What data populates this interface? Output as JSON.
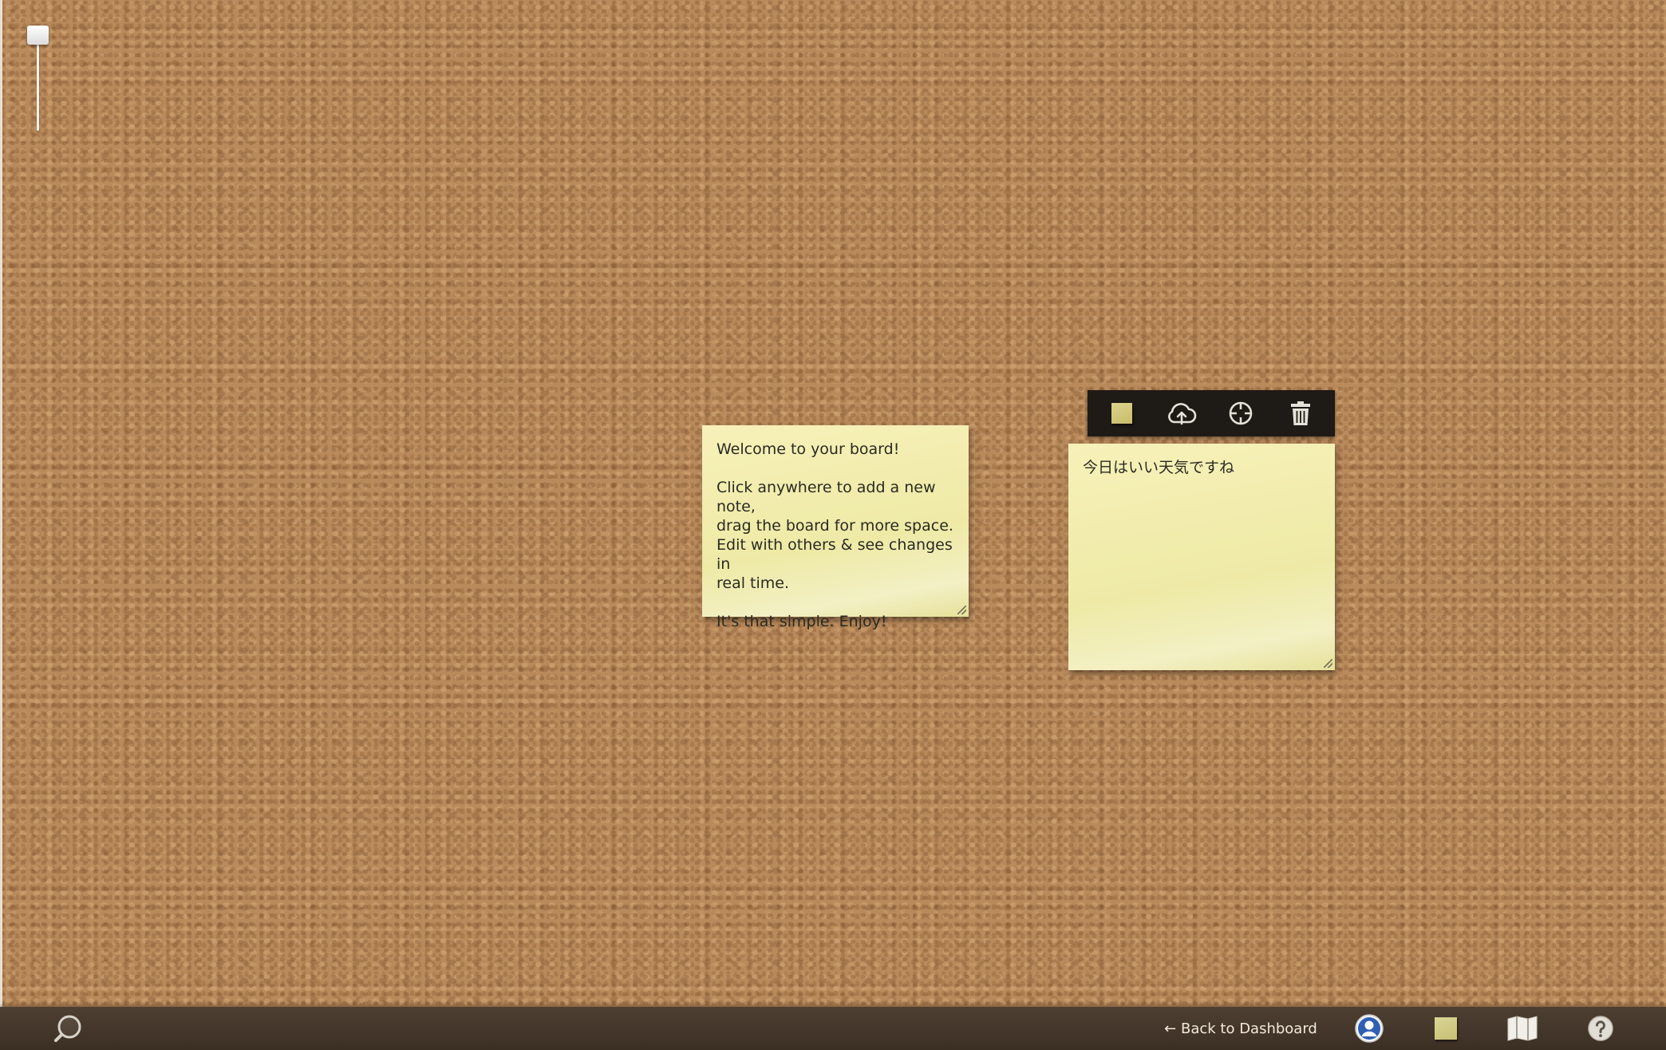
{
  "board": {
    "notes": [
      {
        "text": "Welcome to your board!\n\nClick anywhere to add a new note,\ndrag the board for more space.\nEdit with others & see changes in\nreal time.\n\nIt's that simple. Enjoy!"
      },
      {
        "text": "今日はいい天気ですね"
      }
    ]
  },
  "note_toolbar": {
    "icons": [
      "color-swatch-icon",
      "upload-cloud-icon",
      "crosshair-icon",
      "trash-icon"
    ]
  },
  "bottom_bar": {
    "back_label": "← Back to Dashboard",
    "icons": [
      "search-icon",
      "user-icon",
      "note-icon",
      "map-icon",
      "help-icon"
    ]
  },
  "colors": {
    "note_yellow": "#eeeaa6",
    "toolbar_bg": "#1e1a16",
    "bottom_bar_bg": "#4a3b2e",
    "cork": "#b98a5b"
  }
}
